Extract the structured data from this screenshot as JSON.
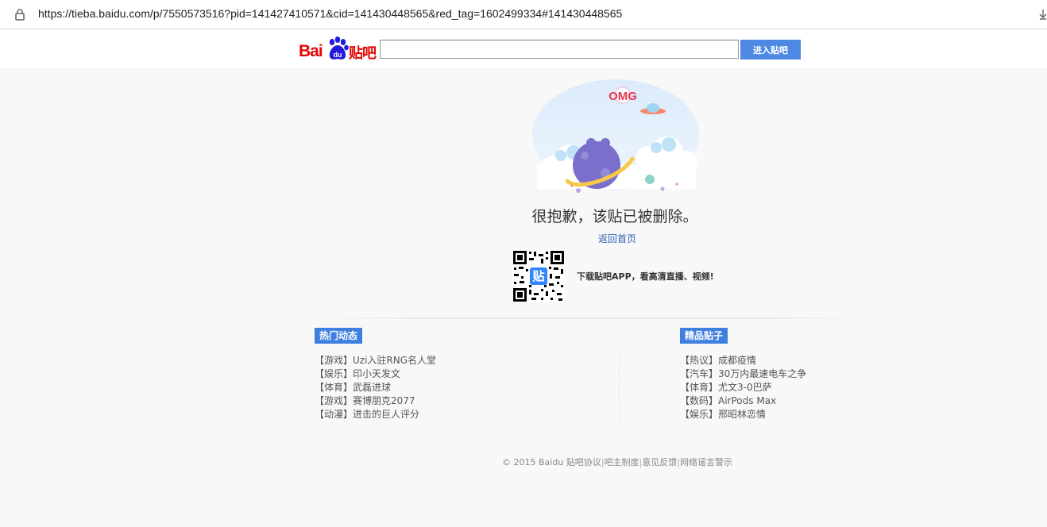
{
  "browser": {
    "url": "https://tieba.baidu.com/p/7550573516?pid=141427410571&cid=141430448565&red_tag=1602499334#141430448565"
  },
  "header": {
    "logo_bai": "Bai",
    "logo_tieba": "贴吧",
    "logo_du": "du",
    "search_value": "",
    "enter_button": "进入贴吧",
    "brand_color": "#e10601",
    "button_color": "#4e8ae3"
  },
  "error": {
    "illustration_text": "OMG",
    "message": "很抱歉，该贴已被删除。",
    "home_link": "返回首页",
    "qr_badge": "贴",
    "app_promo": "下载贴吧APP，看高清直播、视频!"
  },
  "hot": {
    "title": "热门动态",
    "items": [
      {
        "tag": "【游戏】",
        "text": "Uzi入驻RNG名人堂"
      },
      {
        "tag": "【娱乐】",
        "text": "印小天发文"
      },
      {
        "tag": "【体育】",
        "text": "武磊进球"
      },
      {
        "tag": "【游戏】",
        "text": "赛博朋克2077"
      },
      {
        "tag": "【动漫】",
        "text": "进击的巨人评分"
      }
    ]
  },
  "featured": {
    "title": "精品贴子",
    "items": [
      {
        "tag": "【热议】",
        "text": "成都疫情"
      },
      {
        "tag": "【汽车】",
        "text": "30万内最速电车之争"
      },
      {
        "tag": "【体育】",
        "text": "尤文3-0巴萨"
      },
      {
        "tag": "【数码】",
        "text": "AirPods Max"
      },
      {
        "tag": "【娱乐】",
        "text": "邢昭林恋情"
      }
    ]
  },
  "footer": {
    "copyright": "© 2015 Baidu",
    "links": [
      "贴吧协议",
      "吧主制度",
      "意见反馈",
      "网络谣言警示"
    ],
    "separator": "|"
  }
}
